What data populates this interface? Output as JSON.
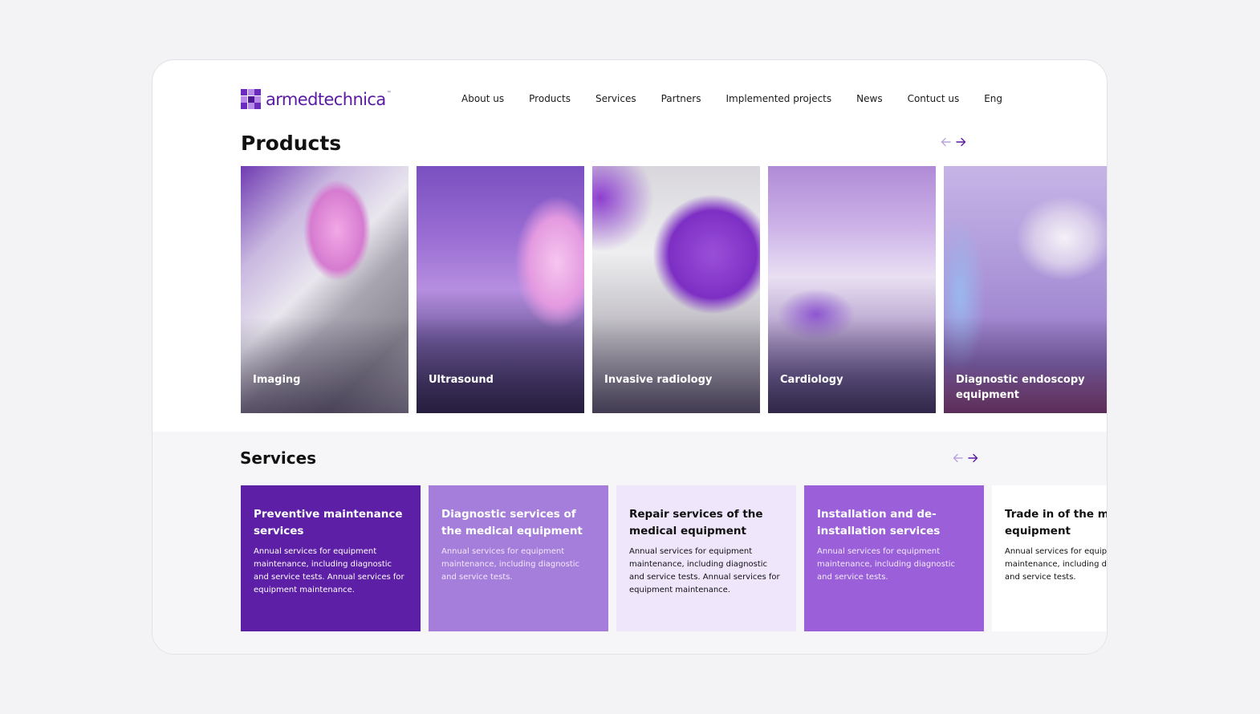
{
  "brand": {
    "name": "armedtechnica",
    "tm": "™",
    "accent": "#5a1aa6"
  },
  "nav": {
    "items": [
      {
        "label": "About us"
      },
      {
        "label": "Products"
      },
      {
        "label": "Services"
      },
      {
        "label": "Partners"
      },
      {
        "label": "Implemented projects"
      },
      {
        "label": "News"
      },
      {
        "label": "Contuct us"
      },
      {
        "label": "Eng"
      }
    ]
  },
  "products": {
    "title": "Products",
    "cards": [
      {
        "label": "Imaging"
      },
      {
        "label": "Ultrasound"
      },
      {
        "label": "Invasive radiology"
      },
      {
        "label": "Cardiology"
      },
      {
        "label": "Diagnostic endoscopy equipment"
      }
    ]
  },
  "services": {
    "title": "Services",
    "cards": [
      {
        "title": "Preventive maintenance services",
        "text": "Annual services for equipment maintenance, including diagnostic and service tests. Annual services for equipment maintenance."
      },
      {
        "title": "Diagnostic services of the medical equipment",
        "text": "Annual services for equipment maintenance, including diagnostic and service tests."
      },
      {
        "title": "Repair services of the medical equipment",
        "text": "Annual services for equipment maintenance, including diagnostic and service tests. Annual services for equipment maintenance."
      },
      {
        "title": "Installation and de-installation services",
        "text": "Annual services for equipment maintenance, including diagnostic and service tests."
      },
      {
        "title": "Trade in of the medical equipment",
        "text": "Annual services for equipment maintenance, including diagnostic and service tests."
      }
    ]
  },
  "colors": {
    "deep_purple": "#5e1fa7",
    "light_purple": "#a57ddb",
    "pale_lilac": "#efe6fb",
    "mid_purple": "#9a5fd9"
  }
}
